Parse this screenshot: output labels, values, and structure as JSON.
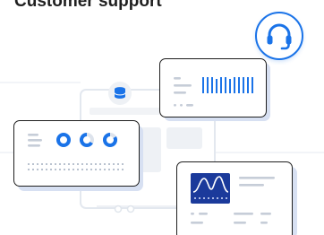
{
  "heading": "Customer support",
  "icons": {
    "support": "headset-icon",
    "database": "database-icon"
  },
  "colors": {
    "accent": "#1a73e8",
    "ink": "#1f1f1f",
    "navy": "#1b3a9b",
    "muted": "#c6cdd8",
    "faint": "#e3e8ef"
  }
}
